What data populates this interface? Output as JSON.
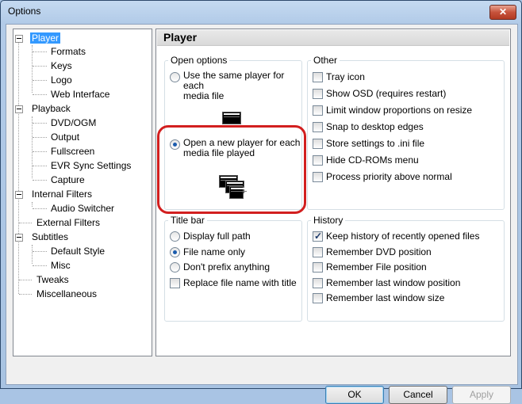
{
  "window": {
    "title": "Options",
    "close_glyph": "✕"
  },
  "tree": {
    "items": [
      {
        "label": "Player",
        "level": 0,
        "selected": true,
        "expander": true
      },
      {
        "label": "Formats",
        "level": 1
      },
      {
        "label": "Keys",
        "level": 1
      },
      {
        "label": "Logo",
        "level": 1
      },
      {
        "label": "Web Interface",
        "level": 1
      },
      {
        "label": "Playback",
        "level": 0,
        "expander": true
      },
      {
        "label": "DVD/OGM",
        "level": 1
      },
      {
        "label": "Output",
        "level": 1
      },
      {
        "label": "Fullscreen",
        "level": 1
      },
      {
        "label": "EVR Sync Settings",
        "level": 1
      },
      {
        "label": "Capture",
        "level": 1
      },
      {
        "label": "Internal Filters",
        "level": 0,
        "expander": true
      },
      {
        "label": "Audio Switcher",
        "level": 1
      },
      {
        "label": "External Filters",
        "level": 0
      },
      {
        "label": "Subtitles",
        "level": 0,
        "expander": true
      },
      {
        "label": "Default Style",
        "level": 1
      },
      {
        "label": "Misc",
        "level": 1
      },
      {
        "label": "Tweaks",
        "level": 0
      },
      {
        "label": "Miscellaneous",
        "level": 0
      }
    ]
  },
  "page": {
    "title": "Player",
    "open_options": {
      "title": "Open options",
      "same_player": "Use the same player for each media file",
      "same_player_line2": "media file",
      "new_player": "Open a new player for each",
      "new_player_line2": "media file played",
      "selected": "new_player"
    },
    "other": {
      "title": "Other",
      "items": [
        {
          "label": "Tray icon",
          "checked": false
        },
        {
          "label": "Show OSD (requires restart)",
          "checked": false
        },
        {
          "label": "Limit window proportions on resize",
          "checked": false
        },
        {
          "label": "Snap to desktop edges",
          "checked": false
        },
        {
          "label": "Store settings to .ini file",
          "checked": false
        },
        {
          "label": "Hide CD-ROMs menu",
          "checked": false
        },
        {
          "label": "Process priority above normal",
          "checked": false
        }
      ]
    },
    "title_bar": {
      "title": "Title bar",
      "options": [
        {
          "label": "Display full path",
          "selected": false
        },
        {
          "label": "File name only",
          "selected": true
        },
        {
          "label": "Don't prefix anything",
          "selected": false
        }
      ],
      "replace": {
        "label": "Replace file name with title",
        "checked": false
      }
    },
    "history": {
      "title": "History",
      "items": [
        {
          "label": "Keep history of recently opened files",
          "checked": true
        },
        {
          "label": "Remember DVD position",
          "checked": false
        },
        {
          "label": "Remember File position",
          "checked": false
        },
        {
          "label": "Remember last window position",
          "checked": false
        },
        {
          "label": "Remember last window size",
          "checked": false
        }
      ]
    }
  },
  "buttons": {
    "ok": "OK",
    "cancel": "Cancel",
    "apply": "Apply"
  }
}
